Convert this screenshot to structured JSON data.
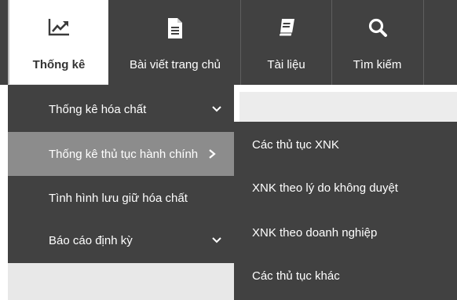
{
  "nav": {
    "items": [
      {
        "label": "Thống kê",
        "icon": "trend-chart-icon",
        "active": true
      },
      {
        "label": "Bài viết trang chủ",
        "icon": "document-icon",
        "active": false
      },
      {
        "label": "Tài liệu",
        "icon": "book-icon",
        "active": false
      },
      {
        "label": "Tìm kiếm",
        "icon": "search-icon",
        "active": false
      }
    ]
  },
  "submenu": {
    "items": [
      {
        "label": "Thống kê hóa chất",
        "chevron": "chevron-down-icon"
      },
      {
        "label": "Thống kê thủ tục hành chính",
        "chevron": "chevron-right-icon"
      },
      {
        "label": "Tình hình lưu giữ hóa chất"
      },
      {
        "label": "Báo cáo định kỳ",
        "chevron": "chevron-down-icon"
      }
    ]
  },
  "flyout": {
    "items": [
      {
        "label": "Các thủ tục XNK"
      },
      {
        "label": "XNK theo lý do không duyệt"
      },
      {
        "label": "XNK theo doanh nghiệp"
      },
      {
        "label": "Các thủ tục khác"
      }
    ]
  },
  "colors": {
    "bar": "#414141",
    "highlight": "#8c8c8c",
    "text": "#ffffff"
  }
}
